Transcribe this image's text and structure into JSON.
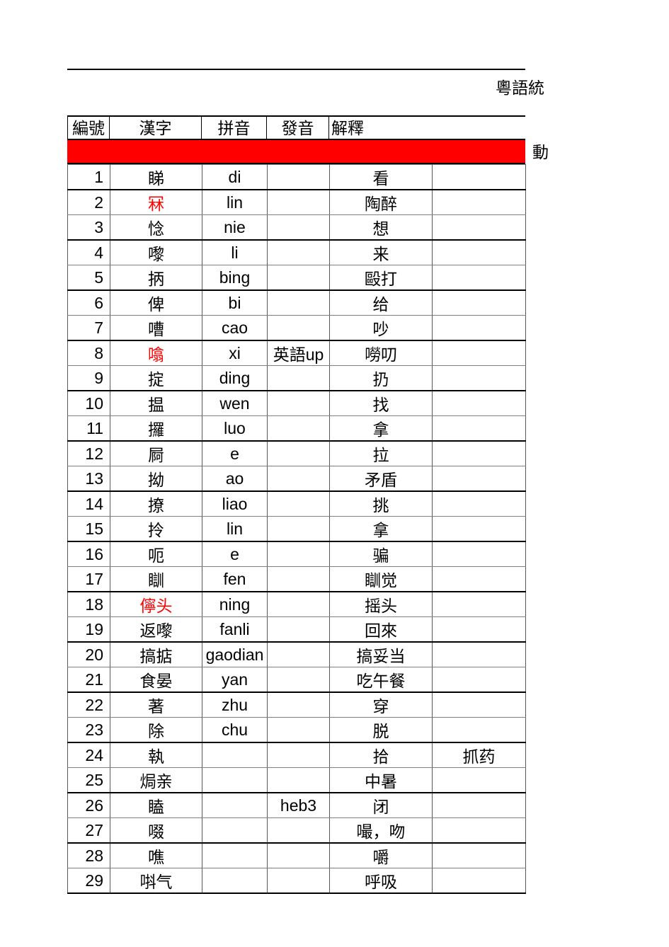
{
  "title": {
    "text": "粵語統"
  },
  "group_label": "動",
  "columns": [
    {
      "key": "num",
      "label": "編號"
    },
    {
      "key": "han",
      "label": "漢字"
    },
    {
      "key": "pin",
      "label": "拼音"
    },
    {
      "key": "pron",
      "label": "發音"
    },
    {
      "key": "expl",
      "label": "解釋"
    },
    {
      "key": "extra",
      "label": ""
    }
  ],
  "colors": {
    "band": "#FF0000",
    "highlight_text": "#FF0000",
    "grid_line": "#595959",
    "heavy_line": "#000000"
  },
  "rows": [
    {
      "num": "1",
      "han": "睇",
      "han_red": false,
      "pin": "di",
      "pron": "",
      "expl": "看",
      "extra": ""
    },
    {
      "num": "2",
      "han": "冧",
      "han_red": true,
      "pin": "lin",
      "pron": "",
      "expl": "陶醉",
      "extra": ""
    },
    {
      "num": "3",
      "han": "惗",
      "han_red": false,
      "pin": "nie",
      "pron": "",
      "expl": "想",
      "extra": ""
    },
    {
      "num": "4",
      "han": "嚟",
      "han_red": false,
      "pin": "li",
      "pron": "",
      "expl": "来",
      "extra": ""
    },
    {
      "num": "5",
      "han": "抦",
      "han_red": false,
      "pin": "bing",
      "pron": "",
      "expl": "毆打",
      "extra": ""
    },
    {
      "num": "6",
      "han": "俾",
      "han_red": false,
      "pin": "bi",
      "pron": "",
      "expl": "给",
      "extra": ""
    },
    {
      "num": "7",
      "han": "嘈",
      "han_red": false,
      "pin": "cao",
      "pron": "",
      "expl": "吵",
      "extra": ""
    },
    {
      "num": "8",
      "han": "噏",
      "han_red": true,
      "pin": "xi",
      "pron": "英語up",
      "expl": "嘮叨",
      "extra": ""
    },
    {
      "num": "9",
      "han": "掟",
      "han_red": false,
      "pin": "ding",
      "pron": "",
      "expl": "扔",
      "extra": ""
    },
    {
      "num": "10",
      "han": "揾",
      "han_red": false,
      "pin": "wen",
      "pron": "",
      "expl": "找",
      "extra": ""
    },
    {
      "num": "11",
      "han": "攞",
      "han_red": false,
      "pin": "luo",
      "pron": "",
      "expl": "拿",
      "extra": ""
    },
    {
      "num": "12",
      "han": "屙",
      "han_red": false,
      "pin": "e",
      "pron": "",
      "expl": "拉",
      "extra": ""
    },
    {
      "num": "13",
      "han": "拗",
      "han_red": false,
      "pin": "ao",
      "pron": "",
      "expl": "矛盾",
      "extra": ""
    },
    {
      "num": "14",
      "han": "撩",
      "han_red": false,
      "pin": "liao",
      "pron": "",
      "expl": "挑",
      "extra": ""
    },
    {
      "num": "15",
      "han": "拎",
      "han_red": false,
      "pin": "lin",
      "pron": "",
      "expl": "拿",
      "extra": ""
    },
    {
      "num": "16",
      "han": "呃",
      "han_red": false,
      "pin": "e",
      "pron": "",
      "expl": "骗",
      "extra": ""
    },
    {
      "num": "17",
      "han": "瞓",
      "han_red": false,
      "pin": "fen",
      "pron": "",
      "expl": "瞓觉",
      "extra": ""
    },
    {
      "num": "18",
      "han": "儜头",
      "han_red": true,
      "pin": "ning",
      "pron": "",
      "expl": "摇头",
      "extra": ""
    },
    {
      "num": "19",
      "han": "返嚟",
      "han_red": false,
      "pin": "fanli",
      "pron": "",
      "expl": "回來",
      "extra": ""
    },
    {
      "num": "20",
      "han": "搞掂",
      "han_red": false,
      "pin": "gaodian",
      "pron": "",
      "expl": "搞妥当",
      "extra": ""
    },
    {
      "num": "21",
      "han": "食晏",
      "han_red": false,
      "pin": "yan",
      "pron": "",
      "expl": "吃午餐",
      "extra": ""
    },
    {
      "num": "22",
      "han": "著",
      "han_red": false,
      "pin": "zhu",
      "pron": "",
      "expl": "穿",
      "extra": ""
    },
    {
      "num": "23",
      "han": "除",
      "han_red": false,
      "pin": "chu",
      "pron": "",
      "expl": "脱",
      "extra": ""
    },
    {
      "num": "24",
      "han": "執",
      "han_red": false,
      "pin": "",
      "pron": "",
      "expl": "拾",
      "extra": "抓药"
    },
    {
      "num": "25",
      "han": "焗亲",
      "han_red": false,
      "pin": "",
      "pron": "",
      "expl": "中暑",
      "extra": ""
    },
    {
      "num": "26",
      "han": "瞌",
      "han_red": false,
      "pin": "",
      "pron": "heb3",
      "expl": "闭",
      "extra": ""
    },
    {
      "num": "27",
      "han": "啜",
      "han_red": false,
      "pin": "",
      "pron": "",
      "expl": "嘬，吻",
      "extra": ""
    },
    {
      "num": "28",
      "han": "噍",
      "han_red": false,
      "pin": "",
      "pron": "",
      "expl": "嚼",
      "extra": ""
    },
    {
      "num": "29",
      "han": "唞气",
      "han_red": false,
      "pin": "",
      "pron": "",
      "expl": "呼吸",
      "extra": ""
    }
  ]
}
